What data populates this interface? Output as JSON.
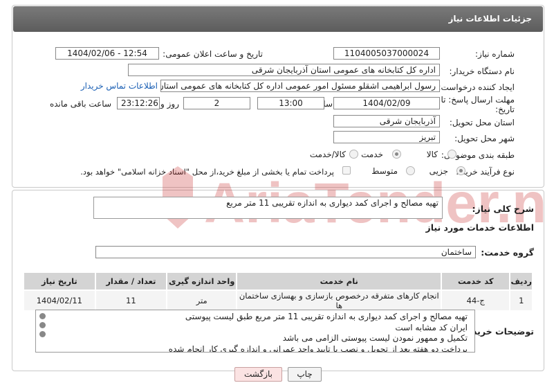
{
  "header": {
    "title": "جزئیات اطلاعات نیاز"
  },
  "form": {
    "need_number_label": "شماره نیاز:",
    "need_number": "1104005037000024",
    "announce_label": "تاریخ و ساعت اعلان عمومی:",
    "announce_value": "1404/02/06 - 12:54",
    "buyer_org_label": "نام دستگاه خریدار:",
    "buyer_org": "اداره کل کتابخانه های عمومی استان آذربایجان شرقی",
    "creator_label": "ایجاد کننده درخواست:",
    "creator": "رسول ابراهیمی اشقلو مسئول امور عمومی اداره کل کتابخانه های عمومی استان",
    "contact_link": "اطلاعات تماس خریدار",
    "deadline_label_1": "مهلت ارسال پاسخ: تا",
    "deadline_label_2": "تاریخ:",
    "deadline_date": "1404/02/09",
    "time_label": "ساعت",
    "deadline_time": "13:00",
    "days_value": "2",
    "days_label": "روز و",
    "remaining_value": "23:12:26",
    "remaining_label": "ساعت باقی مانده",
    "province_label": "استان محل تحویل:",
    "province": "آذربایجان شرقی",
    "city_label": "شهر محل تحویل:",
    "city": "تبریز",
    "category_label": "طبقه بندی موضوعی:",
    "category_options": [
      "کالا",
      "خدمت",
      "کالا/خدمت"
    ],
    "category_selected": "خدمت",
    "process_label": "نوع فرآیند خرید :",
    "process_options": [
      "جزیی",
      "متوسط"
    ],
    "process_selected": "جزیی",
    "payment_note": "پرداخت تمام یا بخشی از مبلغ خرید،از محل \"اسناد خزانه اسلامی\" خواهد بود."
  },
  "summary": {
    "label": "شرح کلی نیاز:",
    "text": "تهیه مصالح و اجرای کمد دیواری به اندازه تقریبی 11 متر مربع"
  },
  "services": {
    "section_title": "اطلاعات خدمات مورد نیاز",
    "group_label": "گروه خدمت:",
    "group_value": "ساختمان",
    "columns": [
      "ردیف",
      "کد خدمت",
      "نام خدمت",
      "واحد اندازه گیری",
      "تعداد / مقدار",
      "تاریخ نیاز"
    ],
    "rows": [
      [
        "1",
        "ج-44",
        "انجام کارهای متفرقه درخصوص بازسازی و بهسازی ساختمان ها",
        "متر",
        "11",
        "1404/02/11"
      ]
    ]
  },
  "buyer_notes": {
    "label": "توضیحات خریدار:",
    "lines": [
      "تهیه مصالح و اجرای کمد دیواری به اندازه تقریبی 11 متر مربع طبق لیست پیوستی",
      "ایران کد مشابه است",
      "تکمیل و ممهور نمودن لیست پیوستی الزامی می باشد",
      "پرداخت دو هفته بعد از تحویل و نصب با تایید واحد عمرانی و اندازه گیری کار انجام شده"
    ]
  },
  "buttons": {
    "print": "چاپ",
    "back": "بازگشت"
  },
  "watermark": {
    "text": "AriaTender.neT"
  }
}
